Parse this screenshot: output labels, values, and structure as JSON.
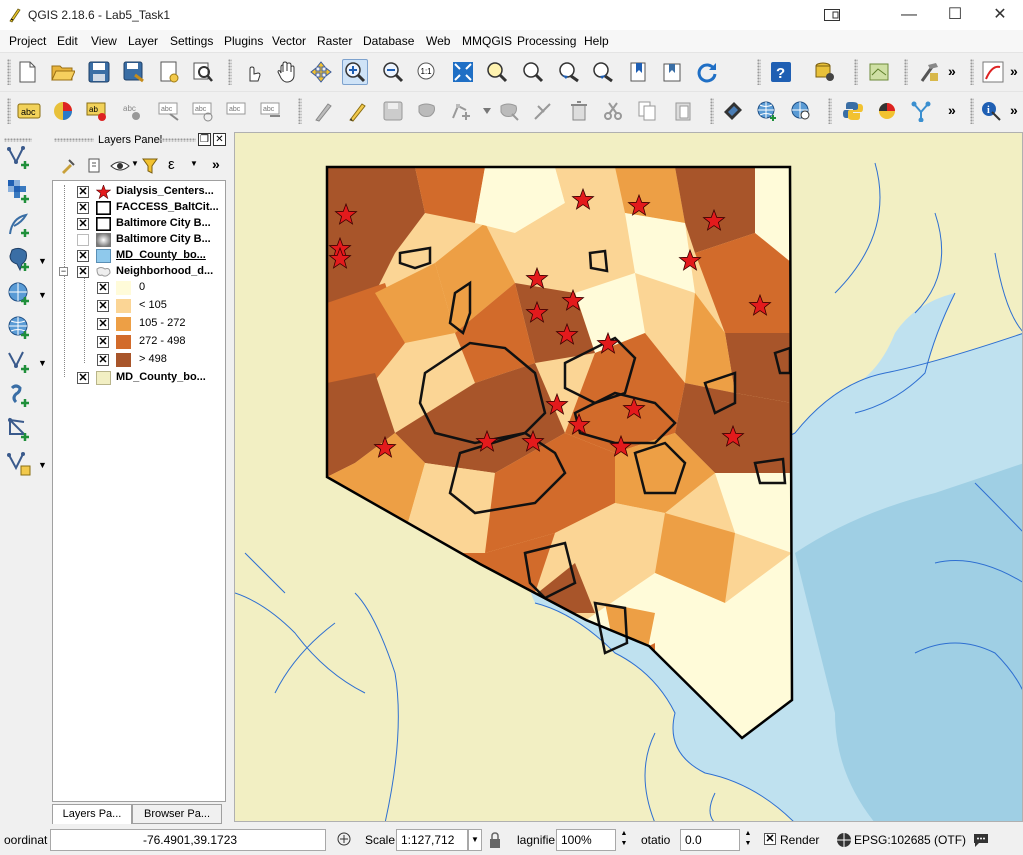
{
  "window": {
    "title": "QGIS 2.18.6 - Lab5_Task1",
    "minimize": "—",
    "maximize": "☐",
    "close": "✕"
  },
  "menu": [
    "Project",
    "Edit",
    "View",
    "Layer",
    "Settings",
    "Plugins",
    "Vector",
    "Raster",
    "Database",
    "Web",
    "MMQGIS",
    "Processing",
    "Help"
  ],
  "toolbar_more": "»",
  "layers_panel": {
    "title": "Layers Panel",
    "float_button": "❐",
    "close_button": "✕",
    "layers": [
      {
        "label": "Dialysis_Centers...",
        "checked": true,
        "symbol": "star-icon"
      },
      {
        "label": "FACCESS_BaltCit...",
        "checked": true,
        "symbol": "polygon-outline-icon"
      },
      {
        "label": "Baltimore City B...",
        "checked": true,
        "symbol": "polygon-outline-icon"
      },
      {
        "label": "Baltimore City B...",
        "checked": false,
        "symbol": "raster-icon"
      },
      {
        "label": "MD_County_bo...",
        "checked": true,
        "symbol": "water-fill-icon"
      },
      {
        "label": "Neighborhood_d...",
        "checked": true,
        "symbol": "graduated-icon"
      },
      {
        "label": "MD_County_bo...",
        "checked": true,
        "symbol": "land-fill-icon"
      }
    ],
    "classes": [
      {
        "label": "0",
        "color": "#fffbd9"
      },
      {
        "label": "< 105",
        "color": "#fbd595"
      },
      {
        "label": "105 - 272",
        "color": "#ed9f45"
      },
      {
        "label": "272 - 498",
        "color": "#d26b2b"
      },
      {
        "label": "> 498",
        "color": "#a8552a"
      }
    ],
    "tabs": [
      "Layers Pa...",
      "Browser Pa..."
    ]
  },
  "status": {
    "coordinate_label": "oordinat",
    "coordinate_value": "-76.4901,39.1723",
    "scale_label": "Scale",
    "scale_value": "1:127,712",
    "magnifier_label": "lagnifie",
    "magnifier_value": "100%",
    "rotation_label": "otatio",
    "rotation_value": "0.0",
    "render_label": "Render",
    "render_checked": true,
    "crs_label": "EPSG:102685 (OTF)"
  },
  "colors": {
    "land": "#f2efc3",
    "water": "#bfe1ef",
    "water_deep": "#9fcfe4",
    "water_lines": "#2e6fd1",
    "dialysis_star": "#e31a1c"
  }
}
